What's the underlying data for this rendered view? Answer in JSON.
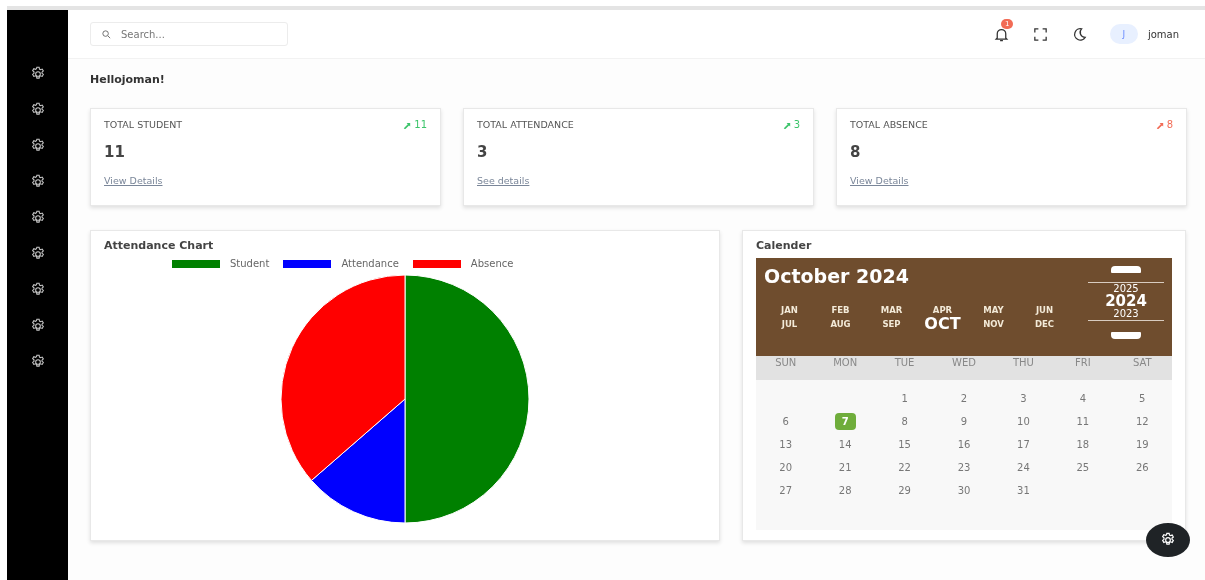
{
  "header": {
    "search": {
      "placeholder": "Search..."
    },
    "notifications": {
      "count": "1"
    },
    "user": {
      "initial": "J",
      "name": "joman"
    }
  },
  "sidebar": {
    "items": [
      {
        "kind": "gear"
      },
      {
        "kind": "gear"
      },
      {
        "kind": "gear"
      },
      {
        "kind": "gear"
      },
      {
        "kind": "gear"
      },
      {
        "kind": "gear"
      },
      {
        "kind": "gear"
      },
      {
        "kind": "gear"
      },
      {
        "kind": "gear"
      }
    ]
  },
  "greeting": "Hellojoman!",
  "stats": [
    {
      "title": "TOTAL STUDENT",
      "trend": "11",
      "color": "#3cc46a",
      "value": "11",
      "link": "View Details"
    },
    {
      "title": "TOTAL ATTENDANCE",
      "trend": "3",
      "color": "#3cc46a",
      "value": "3",
      "link": "See details"
    },
    {
      "title": "TOTAL ABSENCE",
      "trend": "8",
      "color": "#f26b55",
      "value": "8",
      "link": "View Details"
    }
  ],
  "chart": {
    "title": "Attendance Chart",
    "legend": [
      {
        "label": "Student",
        "color": "#008000"
      },
      {
        "label": "Attendance",
        "color": "#0000ff"
      },
      {
        "label": "Absence",
        "color": "#ff0000"
      }
    ],
    "chart_data": {
      "type": "pie",
      "values": [
        50,
        13.6,
        36.4
      ]
    }
  },
  "calendar": {
    "title": "Calender",
    "heading": "October 2024",
    "months": [
      {
        "label": "JAN",
        "selected": false
      },
      {
        "label": "FEB",
        "selected": false
      },
      {
        "label": "MAR",
        "selected": false
      },
      {
        "label": "APR",
        "selected": false
      },
      {
        "label": "MAY",
        "selected": false
      },
      {
        "label": "JUN",
        "selected": false
      },
      {
        "label": "JUL",
        "selected": false
      },
      {
        "label": "AUG",
        "selected": false
      },
      {
        "label": "SEP",
        "selected": false
      },
      {
        "label": "OCT",
        "selected": true
      },
      {
        "label": "NOV",
        "selected": false
      },
      {
        "label": "DEC",
        "selected": false
      }
    ],
    "years": [
      {
        "label": "2025",
        "selected": false
      },
      {
        "label": "2024",
        "selected": true
      },
      {
        "label": "2023",
        "selected": false
      }
    ],
    "weekdays": [
      "SUN",
      "MON",
      "TUE",
      "WED",
      "THU",
      "FRI",
      "SAT"
    ],
    "days": [
      {
        "label": "1",
        "selected": false
      },
      {
        "label": "2",
        "selected": false
      },
      {
        "label": "3",
        "selected": false
      },
      {
        "label": "4",
        "selected": false
      },
      {
        "label": "5",
        "selected": false
      },
      {
        "label": "6",
        "selected": false
      },
      {
        "label": "7",
        "selected": true
      },
      {
        "label": "8",
        "selected": false
      },
      {
        "label": "9",
        "selected": false
      },
      {
        "label": "10",
        "selected": false
      },
      {
        "label": "11",
        "selected": false
      },
      {
        "label": "12",
        "selected": false
      },
      {
        "label": "13",
        "selected": false
      },
      {
        "label": "14",
        "selected": false
      },
      {
        "label": "15",
        "selected": false
      },
      {
        "label": "16",
        "selected": false
      },
      {
        "label": "17",
        "selected": false
      },
      {
        "label": "18",
        "selected": false
      },
      {
        "label": "19",
        "selected": false
      },
      {
        "label": "20",
        "selected": false
      },
      {
        "label": "21",
        "selected": false
      },
      {
        "label": "22",
        "selected": false
      },
      {
        "label": "23",
        "selected": false
      },
      {
        "label": "24",
        "selected": false
      },
      {
        "label": "25",
        "selected": false
      },
      {
        "label": "26",
        "selected": false
      },
      {
        "label": "27",
        "selected": false
      },
      {
        "label": "28",
        "selected": false
      },
      {
        "label": "29",
        "selected": false
      },
      {
        "label": "30",
        "selected": false
      },
      {
        "label": "31",
        "selected": false
      }
    ]
  }
}
